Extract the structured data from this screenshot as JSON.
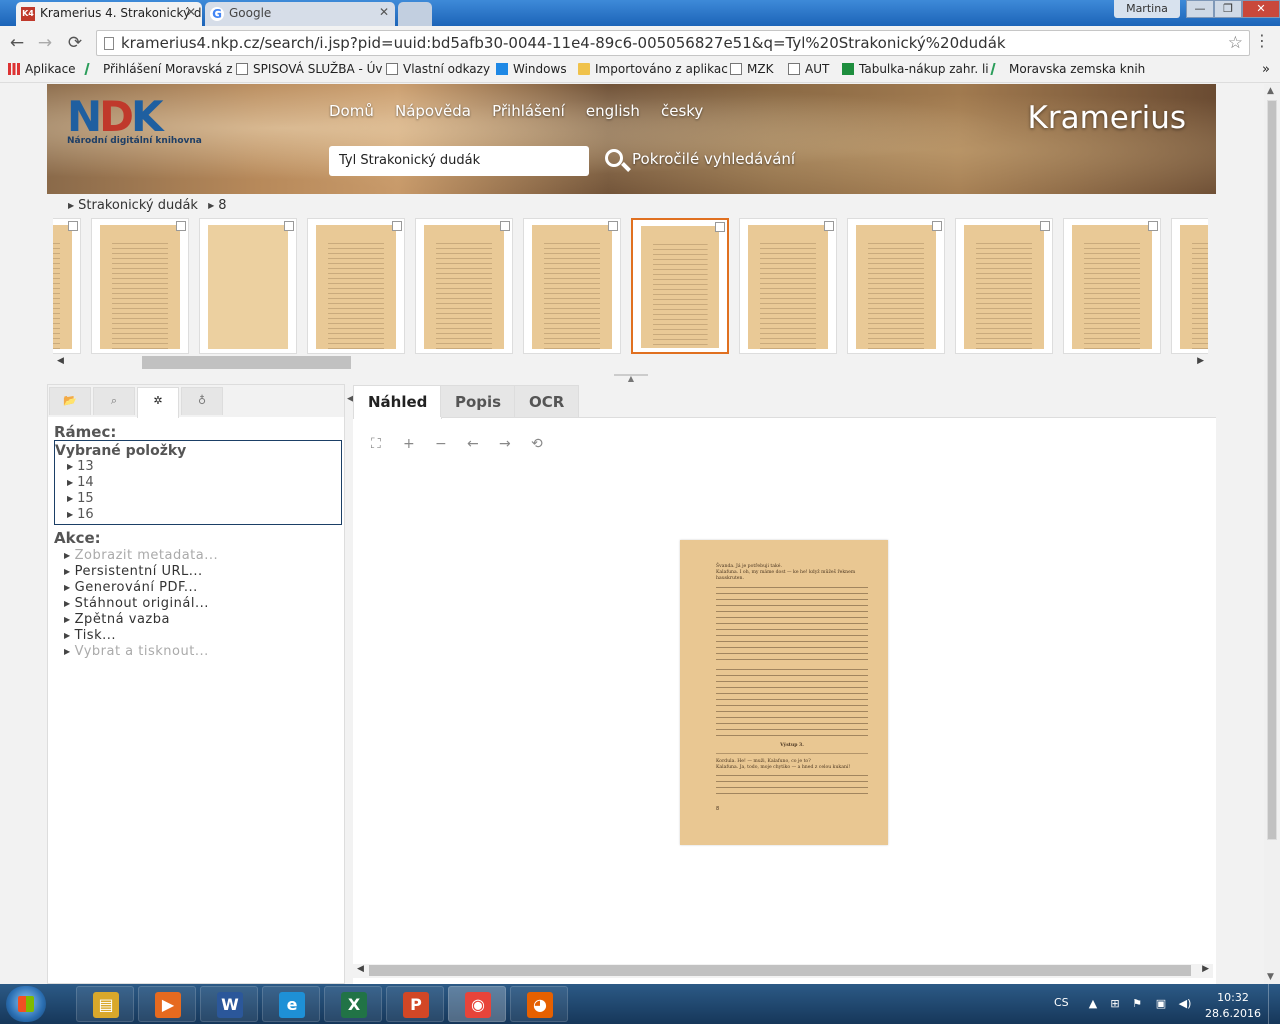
{
  "browser": {
    "tabs": [
      {
        "title": "Kramerius 4. Strakonický d",
        "favicon": "K4",
        "active": true
      },
      {
        "title": "Google",
        "favicon": "G",
        "active": false
      }
    ],
    "user": "Martina",
    "window_controls": {
      "minimize": "—",
      "maximize": "❐",
      "close": "✕"
    },
    "url": "kramerius4.nkp.cz/search/i.jsp?pid=uuid:bd5afb30-0044-11e4-89c6-005056827e51&q=Tyl%20Strakonický%20dudák",
    "nav": {
      "back": "←",
      "forward": "→",
      "reload": "⟳",
      "star": "☆",
      "menu": "⋮"
    },
    "bookmarks": [
      {
        "label": "Aplikace",
        "icon": "apps-icon"
      },
      {
        "label": "Přihlášení  Moravská z",
        "icon": "link-icon"
      },
      {
        "label": "SPISOVÁ SLUŽBA - Úv",
        "icon": "page-icon"
      },
      {
        "label": "Vlastní odkazy",
        "icon": "page-icon"
      },
      {
        "label": "Windows",
        "icon": "windows-icon"
      },
      {
        "label": "Importováno z aplikac",
        "icon": "folder-icon"
      },
      {
        "label": "MZK",
        "icon": "page-icon"
      },
      {
        "label": "AUT",
        "icon": "page-icon"
      },
      {
        "label": "Tabulka-nákup zahr. li",
        "icon": "sheet-icon"
      },
      {
        "label": "Moravska zemska knih",
        "icon": "link-icon"
      }
    ],
    "bookmarks_more": "»"
  },
  "site": {
    "logo_mark_a": "N",
    "logo_mark_b": "D",
    "logo_mark_c": "K",
    "logo_sub": "Národní digitální knihovna",
    "nav": [
      "Domů",
      "Nápověda",
      "Přihlášení",
      "english",
      "česky"
    ],
    "brand": "Kramerius",
    "search_value": "Tyl Strakonický dudák",
    "advanced_search": "Pokročilé vyhledávání",
    "breadcrumb": [
      "Strakonický dudák",
      "8"
    ],
    "thumbnails": {
      "count": 11,
      "selected_index": 5,
      "blank_index": 1
    },
    "left_tabs": [
      {
        "icon": "folder-icon",
        "glyph": "📂",
        "active": false
      },
      {
        "icon": "search-icon",
        "glyph": "⌕",
        "active": false
      },
      {
        "icon": "gear-icon",
        "glyph": "✲",
        "active": true
      },
      {
        "icon": "lightbulb-icon",
        "glyph": "♁",
        "active": false
      }
    ],
    "frame_title": "Rámec:",
    "selected_items_title": "Vybrané položky",
    "selected_items": [
      "13",
      "14",
      "15",
      "16"
    ],
    "actions_title": "Akce:",
    "actions": [
      {
        "label": "Zobrazit metadata...",
        "enabled": false
      },
      {
        "label": "Persistentní URL...",
        "enabled": true
      },
      {
        "label": "Generování PDF...",
        "enabled": true
      },
      {
        "label": "Stáhnout originál...",
        "enabled": true
      },
      {
        "label": "Zpětná vazba",
        "enabled": true
      },
      {
        "label": "Tisk...",
        "enabled": true
      },
      {
        "label": "Vybrat a tisknout...",
        "enabled": false
      }
    ],
    "right_tabs": [
      "Náhled",
      "Popis",
      "OCR"
    ],
    "viewer_tools": [
      {
        "icon": "fullscreen-icon",
        "glyph": "⛶"
      },
      {
        "icon": "zoom-in-icon",
        "glyph": "+"
      },
      {
        "icon": "zoom-out-icon",
        "glyph": "−"
      },
      {
        "icon": "rotate-left-icon",
        "glyph": "←"
      },
      {
        "icon": "rotate-right-icon",
        "glyph": "→"
      },
      {
        "icon": "reset-zoom-icon",
        "glyph": "⟲"
      }
    ],
    "page_text": {
      "line1": "Švanda. Já je potřebuji také.",
      "line2": "Kalafuna. I oh, my máme dost — ke he! když můžeš řeknem hauskruten.",
      "heading": "Výstup 3.",
      "line3": "Kordula. He! — muži, Kalafuno, co je to?",
      "line4": "Kalafuna. Ja, todo, moje chytiko — a hned z celou kukaní!",
      "page_number": "8"
    }
  },
  "taskbar": {
    "apps": [
      {
        "name": "explorer",
        "glyph": "▤",
        "color": "#d9a82b"
      },
      {
        "name": "media-player",
        "glyph": "▶",
        "color": "#e66a1f"
      },
      {
        "name": "word",
        "glyph": "W",
        "color": "#2b579a"
      },
      {
        "name": "internet-explorer",
        "glyph": "e",
        "color": "#1e90d6"
      },
      {
        "name": "excel",
        "glyph": "X",
        "color": "#217346"
      },
      {
        "name": "powerpoint",
        "glyph": "P",
        "color": "#d24726"
      },
      {
        "name": "chrome",
        "glyph": "◉",
        "color": "#e8443a"
      },
      {
        "name": "firefox",
        "glyph": "◕",
        "color": "#e66000"
      }
    ],
    "lang": "CS",
    "time": "10:32",
    "date": "28.6.2016"
  }
}
